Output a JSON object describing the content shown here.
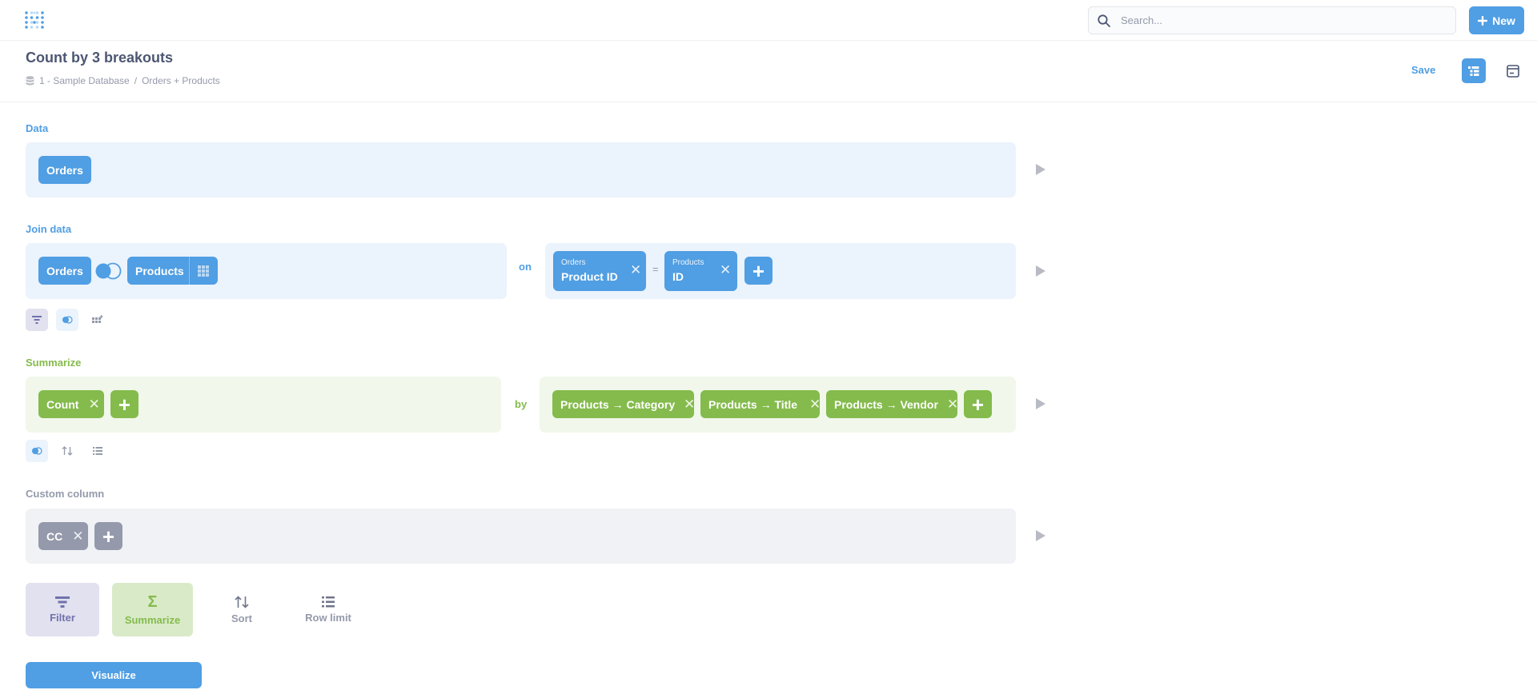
{
  "topnav": {
    "search_placeholder": "Search...",
    "new_label": "New",
    "icons": {
      "logo": "metabase-logo",
      "search": "search-icon",
      "new": "plus-icon"
    }
  },
  "header": {
    "title": "Count by 3 breakouts",
    "database": "1 - Sample Database",
    "separator": "/",
    "table": "Orders + Products",
    "save_label": "Save"
  },
  "data_step": {
    "label": "Data",
    "source_table": "Orders"
  },
  "join_step": {
    "label": "Join data",
    "left_table": "Orders",
    "right_table": "Products",
    "on_label": "on",
    "equals": "=",
    "left_condition": {
      "table": "Orders",
      "field": "Product ID"
    },
    "right_condition": {
      "table": "Products",
      "field": "ID"
    }
  },
  "summarize_step": {
    "label": "Summarize",
    "metrics": [
      "Count"
    ],
    "by_label": "by",
    "breakouts": [
      "Products → Category",
      "Products → Title",
      "Products → Vendor"
    ]
  },
  "custom_column_step": {
    "label": "Custom column",
    "columns": [
      "CC"
    ]
  },
  "actions": {
    "filter": "Filter",
    "summarize": "Summarize",
    "sort": "Sort",
    "row_limit": "Row limit"
  },
  "visualize_label": "Visualize",
  "colors": {
    "brand": "#509ee3",
    "summarize": "#84bb4c",
    "filter": "#7172ad",
    "gray": "#949aab"
  }
}
